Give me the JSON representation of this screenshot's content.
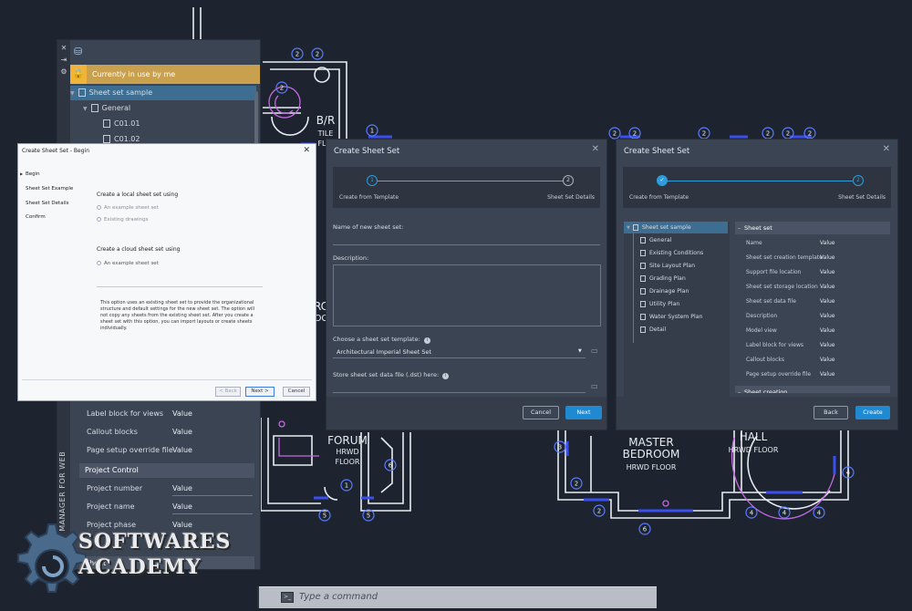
{
  "drawing": {
    "room_labels": [
      "B/R",
      "TILE",
      "FLO",
      "FORUM",
      "HRWD",
      "FLOOR",
      "MASTER",
      "BEDROOM",
      "HRWD FLOOR",
      "HALL",
      "HRWD FLOOR",
      "RC",
      "OC"
    ],
    "tag_numbers": [
      "2",
      "2",
      "2",
      "1",
      "2",
      "2",
      "2",
      "2",
      "2",
      "2",
      "1",
      "6",
      "5",
      "5",
      "3",
      "2",
      "2",
      "6",
      "4",
      "4",
      "4",
      "4"
    ]
  },
  "ssm": {
    "vertical_title": "SHEET SET MANAGER FOR WEB",
    "currently_in_use": "Currently in use by me",
    "tree": [
      {
        "label": "Sheet set sample",
        "selected": true
      },
      {
        "label": "General"
      },
      {
        "label": "C01.01"
      },
      {
        "label": "C01.02"
      }
    ],
    "props": [
      {
        "key": "Label block for views",
        "value": "Value"
      },
      {
        "key": "Callout blocks",
        "value": "Value"
      },
      {
        "key": "Page setup override file",
        "value": "Value"
      }
    ],
    "section_project_control": "Project Control",
    "project_props": [
      {
        "key": "Project number",
        "value": "Value"
      },
      {
        "key": "Project name",
        "value": "Value"
      },
      {
        "key": "Project phase",
        "value": "Value"
      }
    ],
    "last_section_partial": "Sheet"
  },
  "begin_dialog": {
    "title": "Create Sheet Set - Begin",
    "steps": [
      "Begin",
      "Sheet Set Example",
      "Sheet Set Details",
      "Confirm"
    ],
    "local_heading": "Create a local sheet set using",
    "local_options": [
      "An example sheet set",
      "Existing drawings"
    ],
    "cloud_heading": "Create a cloud sheet set using",
    "cloud_options": [
      "An example sheet set"
    ],
    "description": "This option uses an existing sheet set to provide the organizational structure and default settings for the new sheet set.  The option will not copy any sheets from the existing sheet set.  After you create a sheet set with this option, you can import layouts or create sheets individually.",
    "buttons": {
      "back": "< Back",
      "next": "Next >",
      "cancel": "Cancel"
    }
  },
  "create_dialog_1": {
    "title": "Create Sheet Set",
    "step1": "Create from Template",
    "step2": "Sheet Set Details",
    "name_label": "Name of new sheet set:",
    "desc_label": "Description:",
    "template_label": "Choose a sheet set template:",
    "template_value": "Architectural Imperial Sheet Set",
    "store_label": "Store sheet set data file (.dst) here:",
    "cancel": "Cancel",
    "next": "Next"
  },
  "create_dialog_2": {
    "title": "Create Sheet Set",
    "step1": "Create from Template",
    "step2": "Sheet Set Details",
    "tree_root": "Sheet set sample",
    "tree_children": [
      "General",
      "Existing Conditions",
      "Site Layout Plan",
      "Grading Plan",
      "Drainage Plan",
      "Utility Plan",
      "Water System Plan",
      "Detail"
    ],
    "section": "Sheet set",
    "section2_partial": "Sheet creation",
    "props": [
      {
        "key": "Name",
        "value": "Value"
      },
      {
        "key": "Sheet set creation template",
        "value": "Value"
      },
      {
        "key": "Support file location",
        "value": "Value"
      },
      {
        "key": "Sheet set storage location",
        "value": "Value"
      },
      {
        "key": "Sheet set data file",
        "value": "Value"
      },
      {
        "key": "Description",
        "value": "Value"
      },
      {
        "key": "Model view",
        "value": "Value"
      },
      {
        "key": "Label block for views",
        "value": "Value"
      },
      {
        "key": "Callout blocks",
        "value": "Value"
      },
      {
        "key": "Page setup override file",
        "value": "Value"
      }
    ],
    "back": "Back",
    "create": "Create"
  },
  "command_line": {
    "placeholder": "Type a command"
  },
  "watermark": {
    "line1": "SOFTWARES",
    "line2": "ACADEMY"
  },
  "colors": {
    "accent": "#1f8ad2",
    "selection": "#3d6e91",
    "lock": "#f0b43b",
    "cad_bg": "#1d2430"
  }
}
